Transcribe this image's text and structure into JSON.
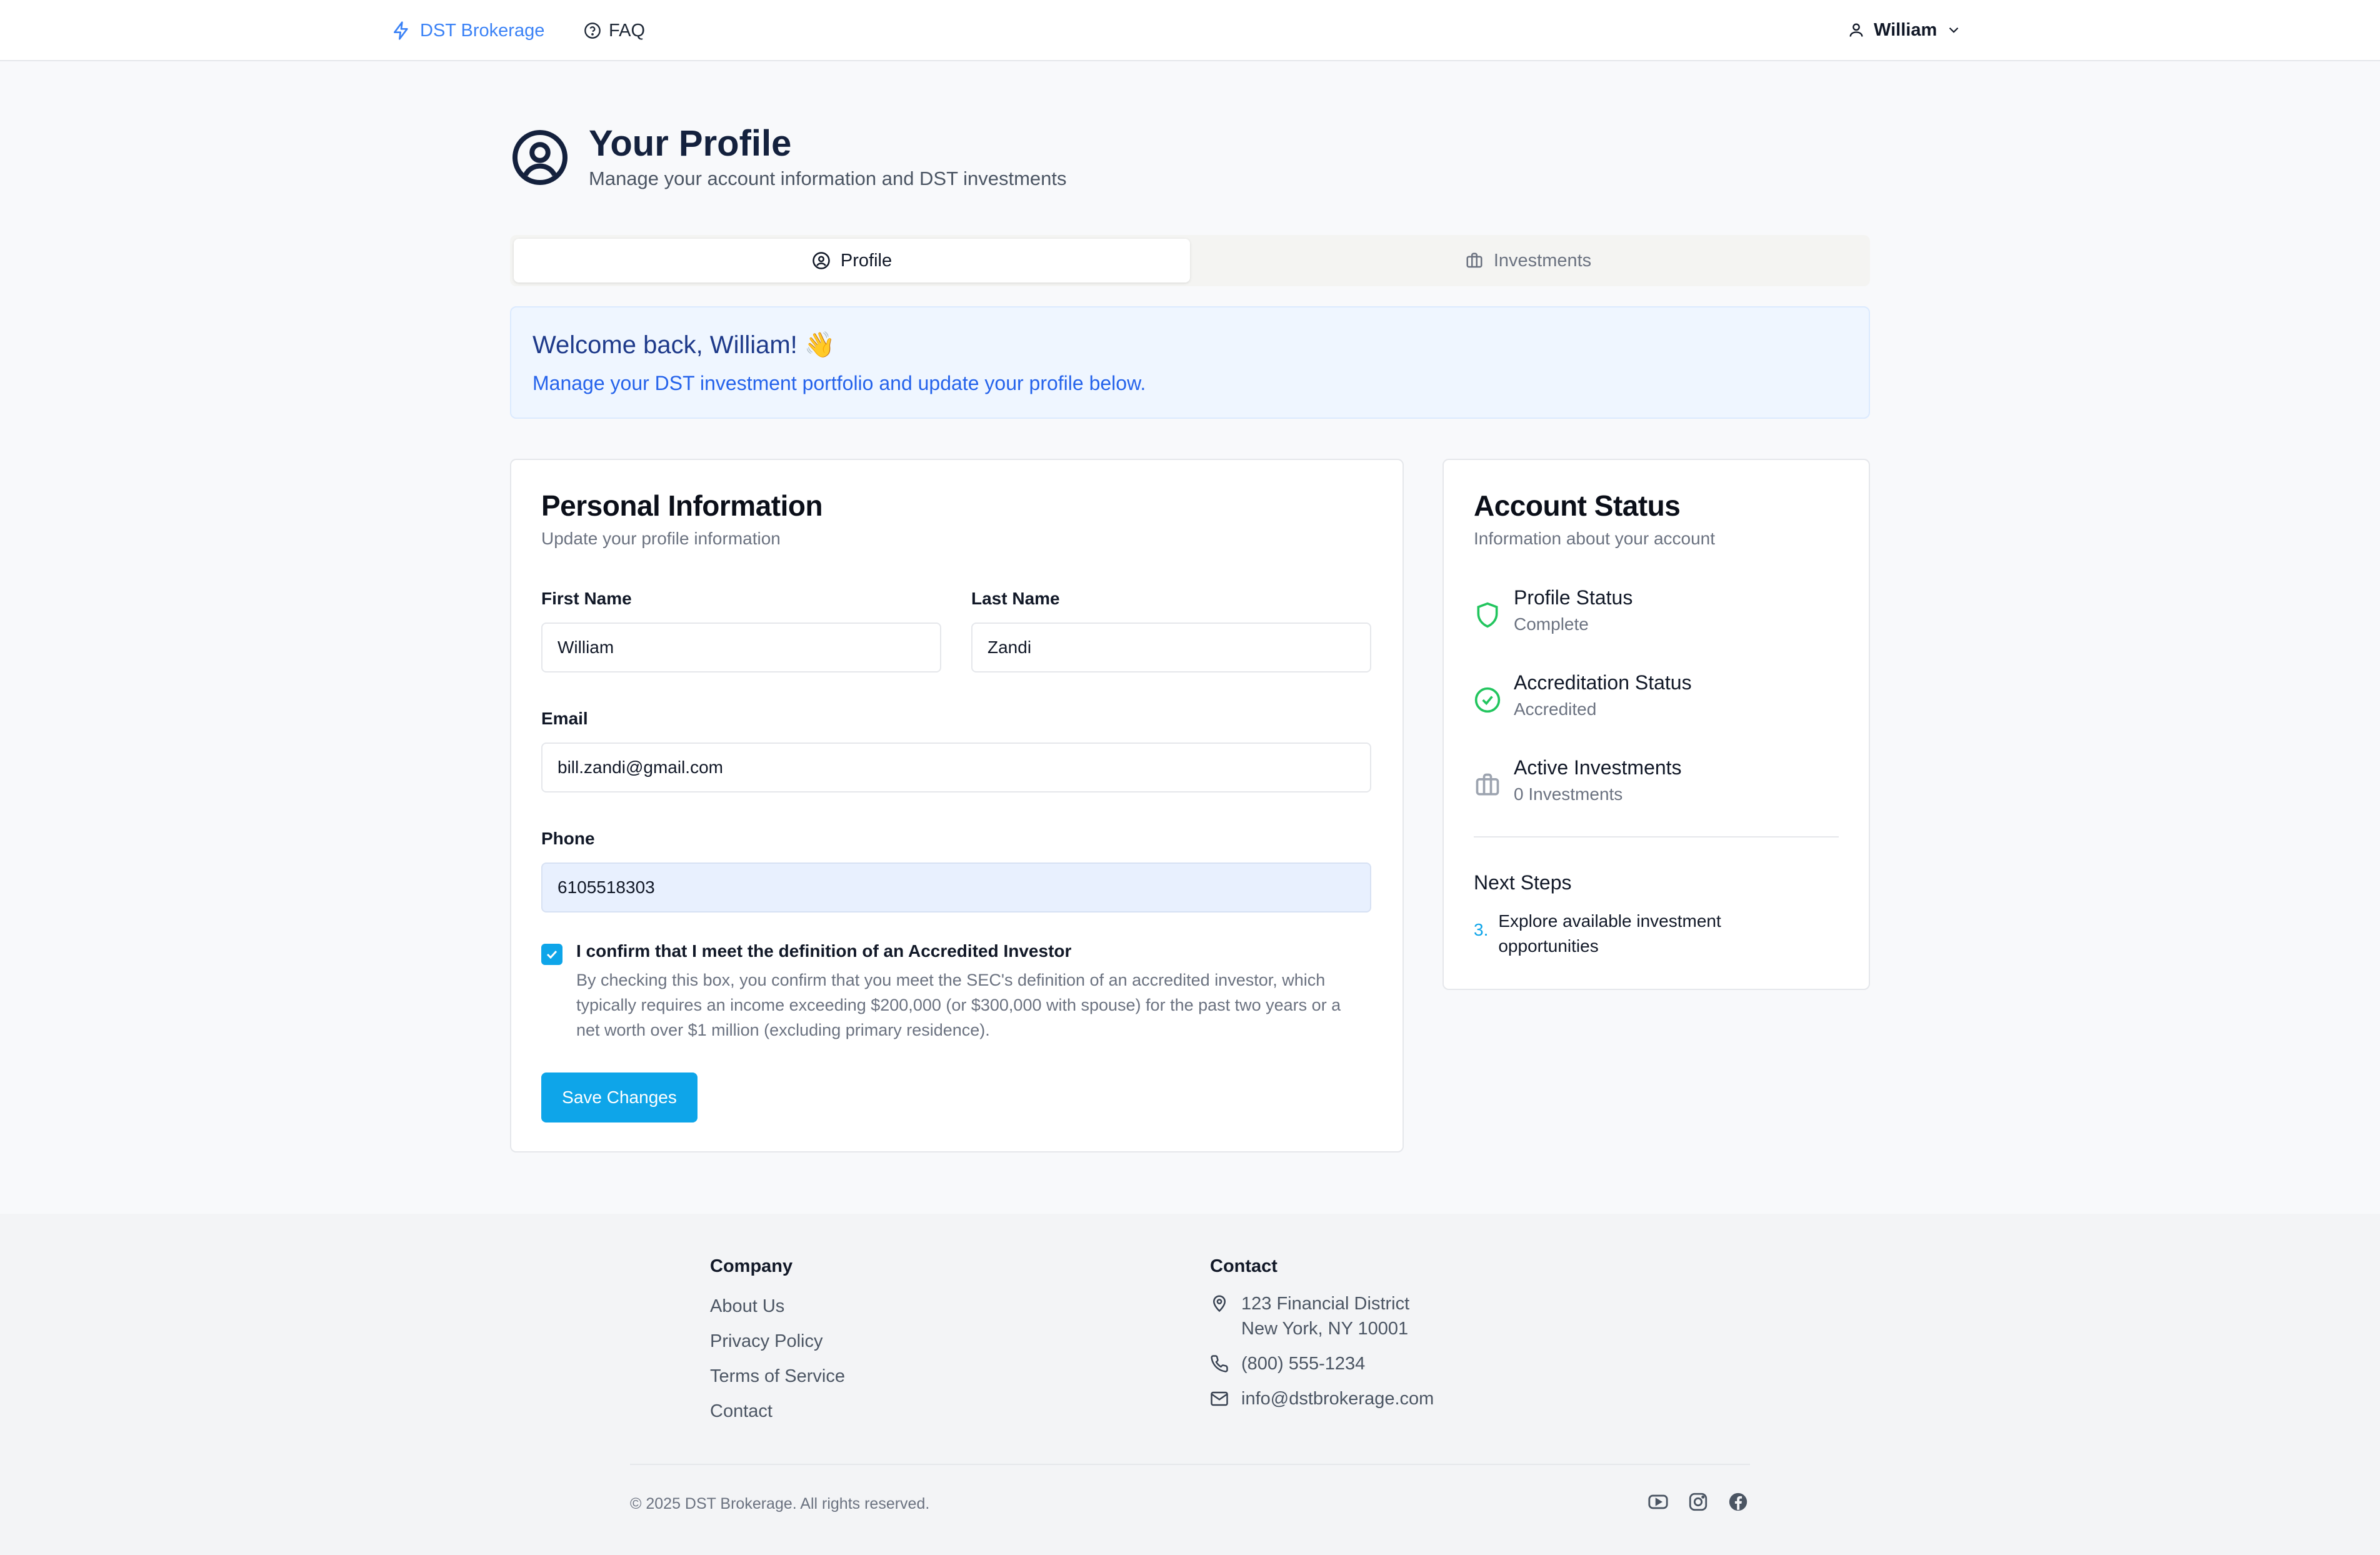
{
  "header": {
    "brand": "DST Brokerage",
    "faq": "FAQ",
    "user": "William"
  },
  "page": {
    "title": "Your Profile",
    "subtitle": "Manage your account information and DST investments"
  },
  "tabs": [
    {
      "label": "Profile",
      "active": true
    },
    {
      "label": "Investments",
      "active": false
    }
  ],
  "welcome": {
    "title": "Welcome back, William! 👋",
    "text": "Manage your DST investment portfolio and update your profile below."
  },
  "personal": {
    "title": "Personal Information",
    "subtitle": "Update your profile information",
    "first_name_label": "First Name",
    "first_name": "William",
    "last_name_label": "Last Name",
    "last_name": "Zandi",
    "email_label": "Email",
    "email": "bill.zandi@gmail.com",
    "phone_label": "Phone",
    "phone": "6105518303",
    "accredited_checked": true,
    "accredited_label": "I confirm that I meet the definition of an Accredited Investor",
    "accredited_help": "By checking this box, you confirm that you meet the SEC's definition of an accredited investor, which typically requires an income exceeding $200,000 (or $300,000 with spouse) for the past two years or a net worth over $1 million (excluding primary residence).",
    "save_label": "Save Changes"
  },
  "status": {
    "title": "Account Status",
    "subtitle": "Information about your account",
    "items": [
      {
        "title": "Profile Status",
        "value": "Complete",
        "icon": "shield-icon"
      },
      {
        "title": "Accreditation Status",
        "value": "Accredited",
        "icon": "check-circle-icon"
      },
      {
        "title": "Active Investments",
        "value": "0 Investments",
        "icon": "briefcase-icon"
      }
    ],
    "next_steps_title": "Next Steps",
    "next_step_number": "3.",
    "next_step_text": "Explore available investment opportunities"
  },
  "footer": {
    "company_heading": "Company",
    "company_links": [
      "About Us",
      "Privacy Policy",
      "Terms of Service",
      "Contact"
    ],
    "contact_heading": "Contact",
    "address_line1": "123 Financial District",
    "address_line2": "New York, NY 10001",
    "phone": "(800) 555-1234",
    "email": "info@dstbrokerage.com",
    "copyright": "© 2025 DST Brokerage. All rights reserved."
  },
  "colors": {
    "accent": "#0ea5e9",
    "brand_blue": "#3b82f6",
    "success_green": "#22c55e",
    "title_navy": "#14213d"
  }
}
